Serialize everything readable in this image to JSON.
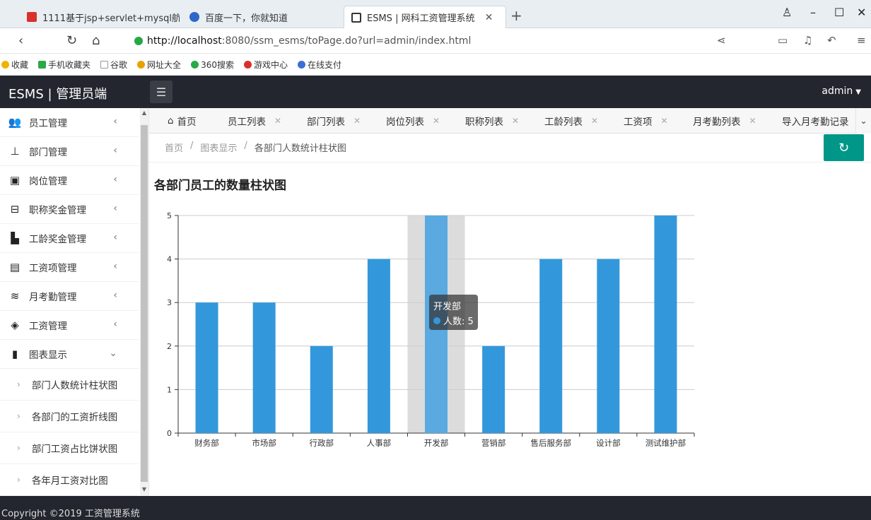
{
  "browser": {
    "tabs": [
      {
        "title": "1111基于jsp+servlet+mysql航..."
      },
      {
        "title": "百度一下，你就知道"
      },
      {
        "title": "ESMS | 网科工资管理系统"
      }
    ],
    "url_host": "http://localhost",
    "url_rest": ":8080/ssm_esms/toPage.do?url=admin/index.html",
    "bookmarks": [
      "收藏",
      "手机收藏夹",
      "谷歌",
      "网址大全",
      "360搜索",
      "游戏中心",
      "在线支付"
    ]
  },
  "header": {
    "app_title": "ESMS | 管理员端",
    "user": "admin"
  },
  "sidebar": {
    "items": [
      {
        "label": "员工管理",
        "icon": "users-icon"
      },
      {
        "label": "部门管理",
        "icon": "sitemap-icon"
      },
      {
        "label": "岗位管理",
        "icon": "badge-icon"
      },
      {
        "label": "职称奖金管理",
        "icon": "briefcase-icon"
      },
      {
        "label": "工龄奖金管理",
        "icon": "building-icon"
      },
      {
        "label": "工资项管理",
        "icon": "card-icon"
      },
      {
        "label": "月考勤管理",
        "icon": "layers-icon"
      },
      {
        "label": "工资管理",
        "icon": "tag-icon"
      },
      {
        "label": "图表显示",
        "icon": "book-icon"
      }
    ],
    "subitems": [
      {
        "label": "部门人数统计柱状图"
      },
      {
        "label": "各部门的工资折线图"
      },
      {
        "label": "部门工资占比饼状图"
      },
      {
        "label": "各年月工资对比图"
      }
    ]
  },
  "page_tabs": [
    {
      "label": "首页"
    },
    {
      "label": "员工列表"
    },
    {
      "label": "部门列表"
    },
    {
      "label": "岗位列表"
    },
    {
      "label": "职称列表"
    },
    {
      "label": "工龄列表"
    },
    {
      "label": "工资项"
    },
    {
      "label": "月考勤列表"
    },
    {
      "label": "导入月考勤记录"
    }
  ],
  "breadcrumb": {
    "home": "首页",
    "section": "图表显示",
    "current": "各部门人数统计柱状图"
  },
  "chart_data": {
    "type": "bar",
    "title": "各部门员工的数量柱状图",
    "categories": [
      "财务部",
      "市场部",
      "行政部",
      "人事部",
      "开发部",
      "营销部",
      "售后服务部",
      "设计部",
      "测试维护部"
    ],
    "series": [
      {
        "name": "人数",
        "values": [
          3,
          3,
          2,
          4,
          5,
          2,
          4,
          4,
          5
        ]
      }
    ],
    "ylim": [
      0,
      5
    ],
    "yticks": [
      0,
      1,
      2,
      3,
      4,
      5
    ],
    "grid": true,
    "bar_color": "#3398db",
    "hover_index": 4,
    "tooltip": {
      "title": "开发部",
      "label": "人数: 5"
    }
  },
  "footer": {
    "copyright": "Copyright ©2019 工资管理系统"
  },
  "colors": {
    "header_bg": "#23262e",
    "accent": "#009688",
    "bar": "#3398db"
  }
}
